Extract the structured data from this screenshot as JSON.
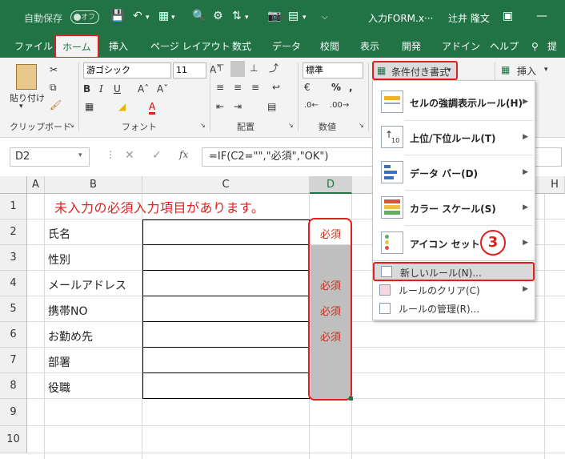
{
  "titlebar": {
    "autosave_label": "自動保存",
    "autosave_state": "オフ",
    "file_name": "入力FORM.x···",
    "user_name": "辻井 隆文"
  },
  "tabs": [
    "ファイル",
    "ホーム",
    "挿入",
    "ページ レイアウト",
    "数式",
    "データ",
    "校閲",
    "表示",
    "開発",
    "アドイン",
    "ヘルプ",
    "提"
  ],
  "ribbon": {
    "paste_label": "貼り付け",
    "font_name": "游ゴシック",
    "font_size": "11",
    "number_format": "標準",
    "cond_format_button": "条件付き書式",
    "insert_button": "挿入",
    "groups": {
      "clipboard": "クリップボード",
      "font": "フォント",
      "alignment": "配置",
      "number": "数値"
    }
  },
  "formula_bar": {
    "name_box": "D2",
    "formula": "=IF(C2=\"\",\"必須\",\"OK\")"
  },
  "grid": {
    "columns": [
      "A",
      "B",
      "C",
      "D",
      "H"
    ],
    "rows": [
      "1",
      "2",
      "3",
      "4",
      "5",
      "6",
      "7",
      "8",
      "9",
      "10"
    ],
    "message": "未入力の必須入力項目があります。",
    "labels": [
      "氏名",
      "性別",
      "メールアドレス",
      "携帯NO",
      "お勤め先",
      "部署",
      "役職"
    ],
    "required": "必須"
  },
  "menu": {
    "items": [
      {
        "label": "セルの強調表示ルール(H)"
      },
      {
        "label": "上位/下位ルール(T)"
      },
      {
        "label": "データ バー(D)"
      },
      {
        "label": "カラー スケール(S)"
      },
      {
        "label": "アイコン セット(I)"
      }
    ],
    "step_number": "3",
    "new_rule": "新しいルール(N)...",
    "clear_rules": "ルールのクリア(C)",
    "manage_rules": "ルールの管理(R)..."
  },
  "colors": {
    "excel_green": "#217346",
    "highlight_red": "#e02020",
    "required_text": "#d0301a",
    "shaded_cell": "#bfbfbf"
  }
}
